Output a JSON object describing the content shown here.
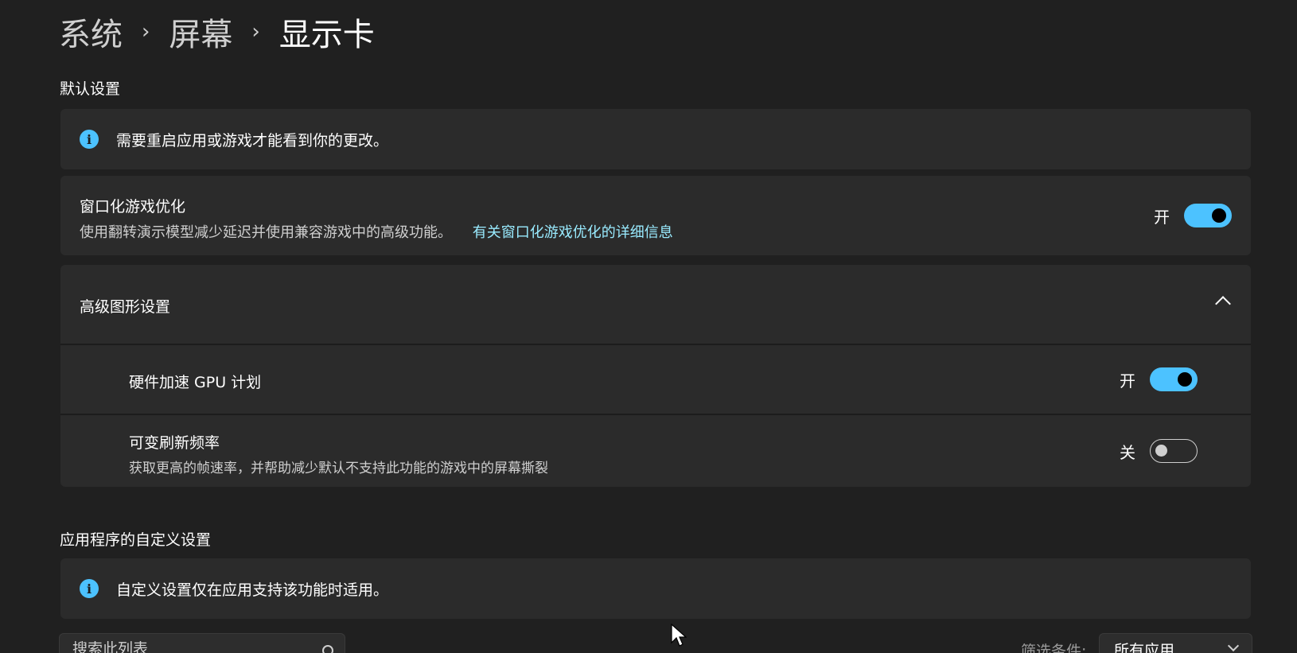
{
  "breadcrumb": {
    "item1": "系统",
    "item2": "屏幕",
    "current": "显示卡"
  },
  "default_settings": {
    "title": "默认设置",
    "info": "需要重启应用或游戏才能看到你的更改。",
    "windowed_opt": {
      "title": "窗口化游戏优化",
      "desc": "使用翻转演示模型减少延迟并使用兼容游戏中的高级功能。",
      "link": "有关窗口化游戏优化的详细信息",
      "state_label": "开",
      "enabled": true
    },
    "advanced": {
      "title": "高级图形设置",
      "gpu_sched": {
        "title": "硬件加速 GPU 计划",
        "state_label": "开",
        "enabled": true
      },
      "vrr": {
        "title": "可变刷新频率",
        "desc": "获取更高的帧速率，并帮助减少默认不支持此功能的游戏中的屏幕撕裂",
        "state_label": "关",
        "enabled": false
      }
    }
  },
  "app_settings": {
    "title": "应用程序的自定义设置",
    "info": "自定义设置仅在应用支持该功能时适用。",
    "search_placeholder": "搜索此列表",
    "filter_label": "筛选条件:",
    "filter_value": "所有应用"
  },
  "colors": {
    "accent": "#4cc2ff",
    "link": "#99ebff",
    "background": "#202020",
    "card": "#2b2b2b"
  },
  "icons": {
    "info": "info-icon",
    "search": "search-icon",
    "expand": "chevron-up-icon",
    "dropdown": "chevron-down-icon"
  }
}
